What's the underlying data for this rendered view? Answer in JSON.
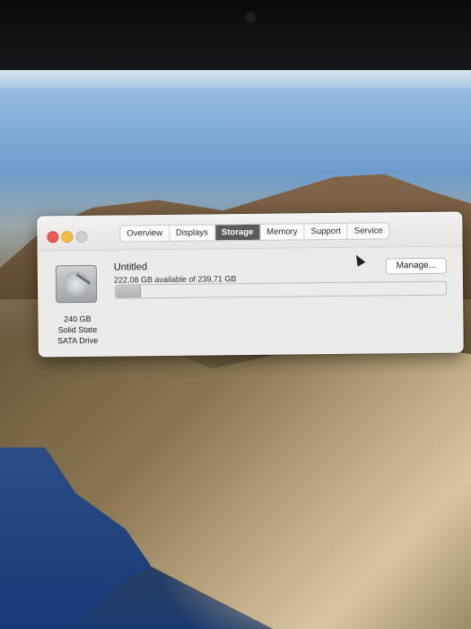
{
  "window": {
    "tabs": [
      {
        "label": "Overview",
        "active": false
      },
      {
        "label": "Displays",
        "active": false
      },
      {
        "label": "Storage",
        "active": true
      },
      {
        "label": "Memory",
        "active": false
      },
      {
        "label": "Support",
        "active": false
      },
      {
        "label": "Service",
        "active": false
      }
    ]
  },
  "storage": {
    "drive_capacity": "240 GB",
    "drive_type_line1": "Solid State",
    "drive_type_line2": "SATA Drive",
    "volume_name": "Untitled",
    "availability": "222,08 GB available of 239,71 GB",
    "used_fraction": 0.074,
    "manage_label": "Manage..."
  },
  "colors": {
    "close": "#ec5b52",
    "minimize": "#f3bd42",
    "zoom": "#cfcfcf",
    "active_tab": "#5b5b5b"
  },
  "icons": [
    "hard-drive-icon",
    "pointer-cursor-icon"
  ]
}
